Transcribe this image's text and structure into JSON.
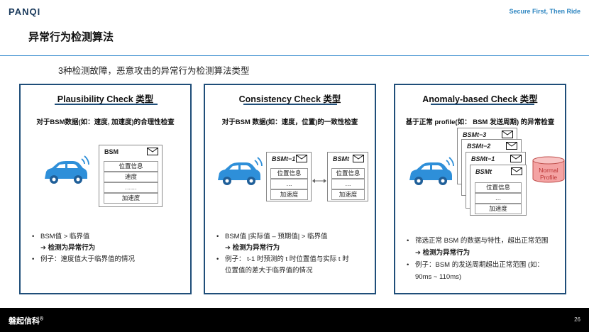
{
  "header": {
    "logo_text": "PANQI",
    "tagline": "Secure First, Then Ride"
  },
  "page_title": "异常行为检测算法",
  "subtitle": "3种检测故障，恶意攻击的异常行为检测算法类型",
  "panels": [
    {
      "title": "Plausibility Check 类型",
      "desc": "对于BSM数据(如：速度, 加速度)的合理性检查",
      "bsm": {
        "title": "BSM",
        "cells": [
          "位置信息",
          "速度",
          "……",
          "加速度"
        ]
      },
      "bullet1": "BSM值 > 临界值",
      "arrow": "➔ 检测为异常行为",
      "bullet2": "例子：速度值大于临界值的情况"
    },
    {
      "title": "Consistency Check 类型",
      "desc": "对于BSM 数据(如：速度，位置)的一致性检查",
      "bsm_prev": {
        "title": "BSMt−1",
        "cells": [
          "位置信息",
          "…",
          "加速度"
        ]
      },
      "bsm_curr": {
        "title": "BSMt",
        "cells": [
          "位置信息",
          "…",
          "加速度"
        ]
      },
      "bullet1": "BSM值 |实际值 – 预期值| > 临界值",
      "arrow": "➔ 检测为异常行为",
      "bullet2_line1": "例子：  t-1 时预测的 t 时位置值与实际 t 时",
      "bullet2_line2": "位置值的差大于临界值的情况"
    },
    {
      "title": "Anomaly-based Check 类型",
      "desc": "基于正常 profile(如：  BSM 发送周期) 的异常检查",
      "stack_titles": [
        "BSMt−3",
        "BSMt−2",
        "BSMt−1",
        "BSMt"
      ],
      "cells": [
        "位置信息",
        "…",
        "加速度"
      ],
      "normal_profile": [
        "Normal",
        "Profile"
      ],
      "bullet1": "筛选正常 BSM 的数据与特性，超出正常范围",
      "arrow": "➔ 检测为异常行为",
      "bullet2_line1": "例子：BSM 的发送周期超出正常范围 (如：",
      "bullet2_line2": "90ms ~ 110ms)"
    }
  ],
  "footer": {
    "brand": "磐起信科",
    "reg_mark": "®",
    "page_number": "26"
  },
  "colors": {
    "panel_border": "#1f4e79",
    "car": "#2e8fd9",
    "profile_fill": "#f4a3a3",
    "rule": "#3b8ed0"
  }
}
